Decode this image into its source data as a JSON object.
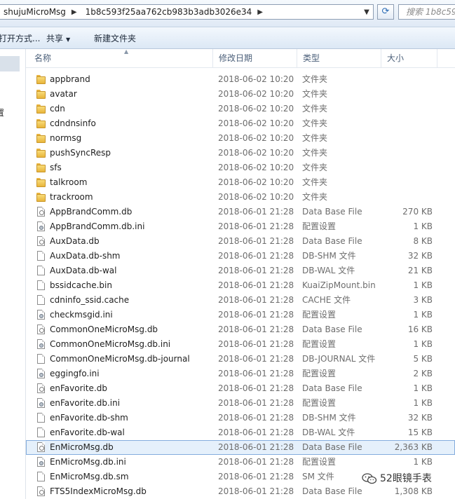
{
  "address": {
    "crumbs": [
      "shujuMicroMsg",
      "1b8c593f25aa762cb983b3adb3026e34"
    ],
    "search_placeholder": "搜索 1b8c59"
  },
  "toolbar": {
    "open_with": "打开方式...",
    "share": "共享",
    "new_folder": "新建文件夹"
  },
  "nav": {
    "partial_label": "置"
  },
  "columns": {
    "name": "名称",
    "date": "修改日期",
    "type": "类型",
    "size": "大小"
  },
  "files": [
    {
      "name": "appbrand",
      "date": "2018-06-02 10:20",
      "type": "文件夹",
      "size": "",
      "icon": "folder"
    },
    {
      "name": "avatar",
      "date": "2018-06-02 10:20",
      "type": "文件夹",
      "size": "",
      "icon": "folder"
    },
    {
      "name": "cdn",
      "date": "2018-06-02 10:20",
      "type": "文件夹",
      "size": "",
      "icon": "folder"
    },
    {
      "name": "cdndnsinfo",
      "date": "2018-06-02 10:20",
      "type": "文件夹",
      "size": "",
      "icon": "folder"
    },
    {
      "name": "normsg",
      "date": "2018-06-02 10:20",
      "type": "文件夹",
      "size": "",
      "icon": "folder"
    },
    {
      "name": "pushSyncResp",
      "date": "2018-06-02 10:20",
      "type": "文件夹",
      "size": "",
      "icon": "folder"
    },
    {
      "name": "sfs",
      "date": "2018-06-02 10:20",
      "type": "文件夹",
      "size": "",
      "icon": "folder"
    },
    {
      "name": "talkroom",
      "date": "2018-06-02 10:20",
      "type": "文件夹",
      "size": "",
      "icon": "folder"
    },
    {
      "name": "trackroom",
      "date": "2018-06-02 10:20",
      "type": "文件夹",
      "size": "",
      "icon": "folder"
    },
    {
      "name": "AppBrandComm.db",
      "date": "2018-06-01 21:28",
      "type": "Data Base File",
      "size": "270 KB",
      "icon": "db"
    },
    {
      "name": "AppBrandComm.db.ini",
      "date": "2018-06-01 21:28",
      "type": "配置设置",
      "size": "1 KB",
      "icon": "ini"
    },
    {
      "name": "AuxData.db",
      "date": "2018-06-01 21:28",
      "type": "Data Base File",
      "size": "8 KB",
      "icon": "db"
    },
    {
      "name": "AuxData.db-shm",
      "date": "2018-06-01 21:28",
      "type": "DB-SHM 文件",
      "size": "32 KB",
      "icon": "file"
    },
    {
      "name": "AuxData.db-wal",
      "date": "2018-06-01 21:28",
      "type": "DB-WAL 文件",
      "size": "21 KB",
      "icon": "file"
    },
    {
      "name": "bssidcache.bin",
      "date": "2018-06-01 21:28",
      "type": "KuaiZipMount.bin",
      "size": "1 KB",
      "icon": "file"
    },
    {
      "name": "cdninfo_ssid.cache",
      "date": "2018-06-01 21:28",
      "type": "CACHE 文件",
      "size": "3 KB",
      "icon": "file"
    },
    {
      "name": "checkmsgid.ini",
      "date": "2018-06-01 21:28",
      "type": "配置设置",
      "size": "1 KB",
      "icon": "ini"
    },
    {
      "name": "CommonOneMicroMsg.db",
      "date": "2018-06-01 21:28",
      "type": "Data Base File",
      "size": "16 KB",
      "icon": "db"
    },
    {
      "name": "CommonOneMicroMsg.db.ini",
      "date": "2018-06-01 21:28",
      "type": "配置设置",
      "size": "1 KB",
      "icon": "ini"
    },
    {
      "name": "CommonOneMicroMsg.db-journal",
      "date": "2018-06-01 21:28",
      "type": "DB-JOURNAL 文件",
      "size": "5 KB",
      "icon": "file"
    },
    {
      "name": "eggingfo.ini",
      "date": "2018-06-01 21:28",
      "type": "配置设置",
      "size": "2 KB",
      "icon": "ini"
    },
    {
      "name": "enFavorite.db",
      "date": "2018-06-01 21:28",
      "type": "Data Base File",
      "size": "1 KB",
      "icon": "db"
    },
    {
      "name": "enFavorite.db.ini",
      "date": "2018-06-01 21:28",
      "type": "配置设置",
      "size": "1 KB",
      "icon": "ini"
    },
    {
      "name": "enFavorite.db-shm",
      "date": "2018-06-01 21:28",
      "type": "DB-SHM 文件",
      "size": "32 KB",
      "icon": "file"
    },
    {
      "name": "enFavorite.db-wal",
      "date": "2018-06-01 21:28",
      "type": "DB-WAL 文件",
      "size": "15 KB",
      "icon": "file"
    },
    {
      "name": "EnMicroMsg.db",
      "date": "2018-06-01 21:28",
      "type": "Data Base File",
      "size": "2,363 KB",
      "icon": "db",
      "selected": true
    },
    {
      "name": "EnMicroMsg.db.ini",
      "date": "2018-06-01 21:28",
      "type": "配置设置",
      "size": "1 KB",
      "icon": "ini"
    },
    {
      "name": "EnMicroMsg.db.sm",
      "date": "2018-06-01 21:28",
      "type": "SM 文件",
      "size": "",
      "icon": "file"
    },
    {
      "name": "FTS5IndexMicroMsg.db",
      "date": "2018-06-01 21:28",
      "type": "Data Base File",
      "size": "1,308 KB",
      "icon": "db"
    }
  ],
  "watermark": {
    "text": "52眼镜手表"
  }
}
